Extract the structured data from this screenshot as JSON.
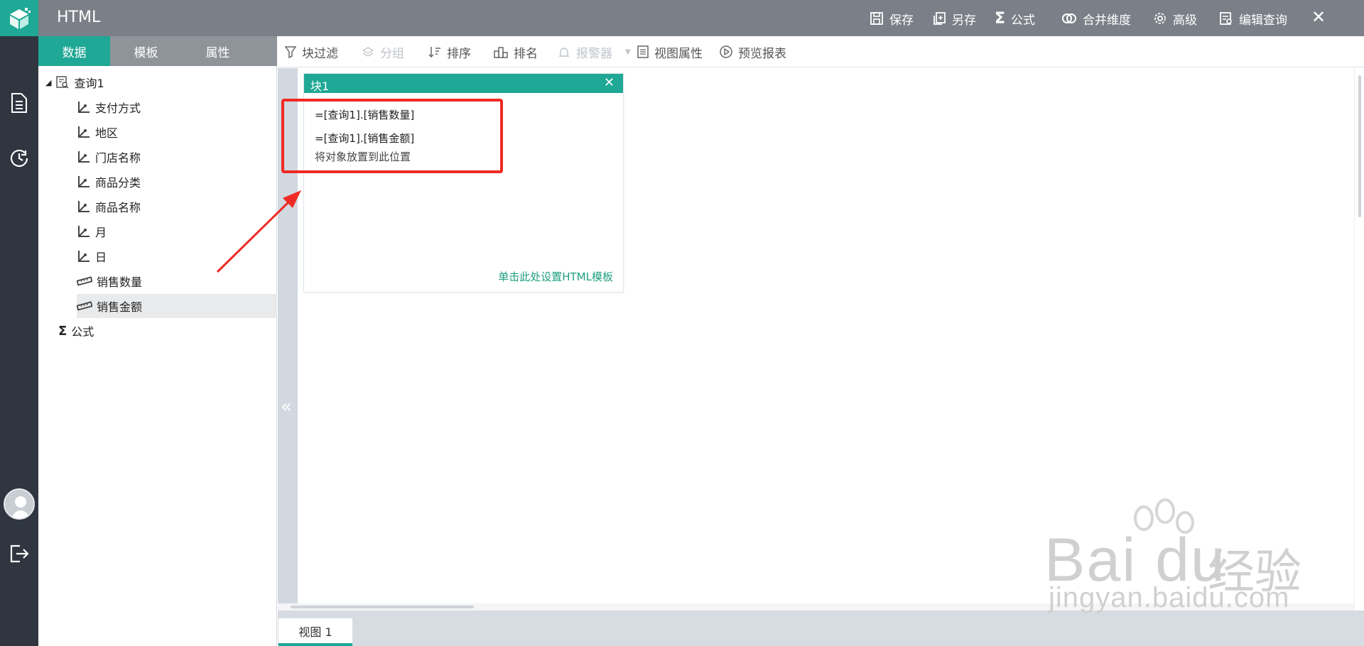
{
  "app": {
    "title": "HTML"
  },
  "topbar": {
    "save": "保存",
    "save_as": "另存",
    "formula": "公式",
    "merge_dimension": "合并维度",
    "advanced": "高级",
    "edit_query": "编辑查询"
  },
  "left_tabs": [
    "数据",
    "模板",
    "属性"
  ],
  "tree": {
    "query": "查询1",
    "dimensions": [
      "支付方式",
      "地区",
      "门店名称",
      "商品分类",
      "商品名称",
      "月",
      "日"
    ],
    "measures": [
      "销售数量",
      "销售金额"
    ],
    "formula": "公式"
  },
  "toolbar": {
    "block_filter": "块过滤",
    "group": "分组",
    "sort": "排序",
    "rank": "排名",
    "alarm": "报警器",
    "view_props": "视图属性",
    "preview": "预览报表"
  },
  "block": {
    "title": "块1",
    "field1": "=[查询1].[销售数量]",
    "field2": "=[查询1].[销售金额]",
    "drop_hint": "将对象放置到此位置",
    "template_link": "单击此处设置HTML模板"
  },
  "bottom_tab": "视图 1",
  "watermark": {
    "brand": "Bai du",
    "cn": "经验",
    "url": "jingyan.baidu.com"
  },
  "colors": {
    "accent": "#1fa895",
    "topbar": "#7b8088",
    "rail": "#2f3640",
    "highlight": "#ee2a24"
  }
}
